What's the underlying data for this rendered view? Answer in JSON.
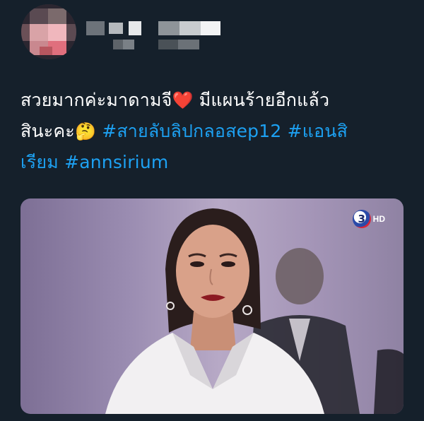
{
  "tweet": {
    "text_line1": "สวยมากค่ะมาดามจี",
    "heart_emoji": "❤️",
    "text_line1b": " มีแผนร้ายอีกแล้ว",
    "text_line2": "สินะคะ",
    "thinking_emoji": "🤔",
    "hashtag1": "#สายลับลิปกลอสep12",
    "hashtag2a": "#แอนสิ",
    "hashtag2b": "เรียม",
    "hashtag3": "#annsirium"
  },
  "media": {
    "watermark_logo": "3",
    "watermark_hd": "HD"
  },
  "colors": {
    "background": "#15202b",
    "text": "#ffffff",
    "hashtag": "#1da1f2"
  },
  "icons": {
    "avatar": "blurred-avatar",
    "channel_logo": "channel-3-logo"
  }
}
